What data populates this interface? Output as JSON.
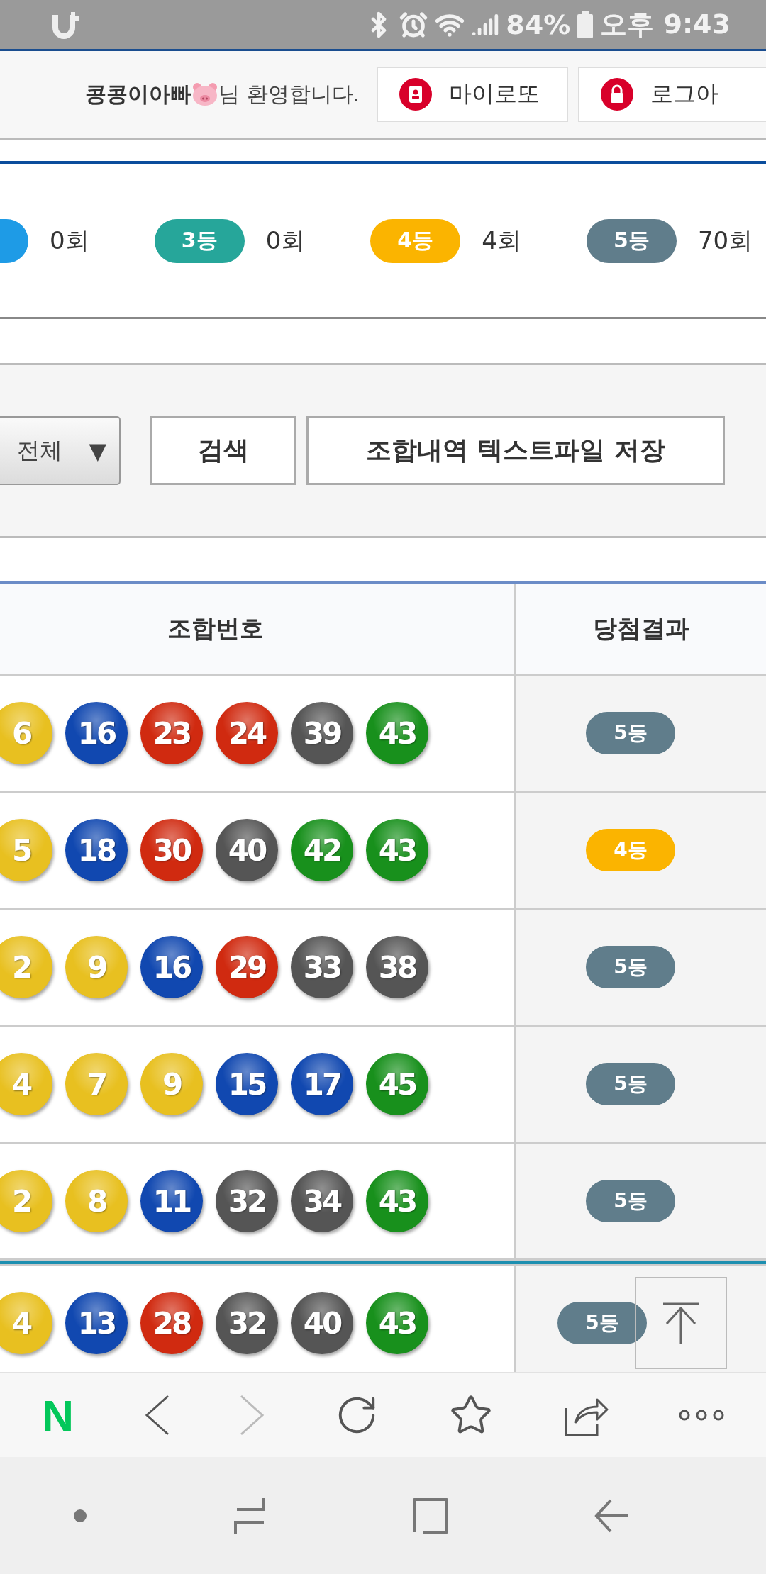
{
  "status_bar": {
    "battery": "84%",
    "time": "오후 9:43"
  },
  "header": {
    "user_name": "콩콩이아빠",
    "welcome": "님 환영합니다.",
    "buttons": [
      {
        "label": "마이로또",
        "kind": "mylotto"
      },
      {
        "label": "로그아",
        "kind": "logout"
      }
    ]
  },
  "stats": [
    {
      "color": "#1e9be6",
      "count": "0회"
    },
    {
      "label": "3등",
      "color": "#26a69a",
      "count": "0회"
    },
    {
      "label": "4등",
      "color": "#fbb400",
      "count": "4회"
    },
    {
      "label": "5등",
      "color": "#607d8b",
      "count": "70회"
    }
  ],
  "filter": {
    "select": "전체",
    "select_arrow": "▼",
    "buttons": [
      "검색",
      "조합내역 텍스트파일 저장"
    ]
  },
  "table": {
    "columns": [
      "조합번호",
      "당첨결과"
    ],
    "groups": [
      {
        "rows": [
          {
            "balls": [
              {
                "number": "6",
                "color": "#e8c020"
              },
              {
                "number": "16",
                "color": "#1148b0"
              },
              {
                "number": "23",
                "color": "#d02a10"
              },
              {
                "number": "24",
                "color": "#d02a10"
              },
              {
                "number": "39",
                "color": "#555555"
              },
              {
                "number": "43",
                "color": "#18901c"
              }
            ],
            "result": {
              "label": "5등",
              "color": "#607d8b"
            }
          },
          {
            "balls": [
              {
                "number": "5",
                "color": "#e8c020"
              },
              {
                "number": "18",
                "color": "#1148b0"
              },
              {
                "number": "30",
                "color": "#d02a10"
              },
              {
                "number": "40",
                "color": "#555555"
              },
              {
                "number": "42",
                "color": "#18901c"
              },
              {
                "number": "43",
                "color": "#18901c"
              }
            ],
            "result": {
              "label": "4등",
              "color": "#fbb400"
            }
          },
          {
            "balls": [
              {
                "number": "2",
                "color": "#e8c020"
              },
              {
                "number": "9",
                "color": "#e8c020"
              },
              {
                "number": "16",
                "color": "#1148b0"
              },
              {
                "number": "29",
                "color": "#d02a10"
              },
              {
                "number": "33",
                "color": "#555555"
              },
              {
                "number": "38",
                "color": "#555555"
              }
            ],
            "result": {
              "label": "5등",
              "color": "#607d8b"
            }
          },
          {
            "balls": [
              {
                "number": "4",
                "color": "#e8c020"
              },
              {
                "number": "7",
                "color": "#e8c020"
              },
              {
                "number": "9",
                "color": "#e8c020"
              },
              {
                "number": "15",
                "color": "#1148b0"
              },
              {
                "number": "17",
                "color": "#1148b0"
              },
              {
                "number": "45",
                "color": "#18901c"
              }
            ],
            "result": {
              "label": "5등",
              "color": "#607d8b"
            }
          },
          {
            "balls": [
              {
                "number": "2",
                "color": "#e8c020"
              },
              {
                "number": "8",
                "color": "#e8c020"
              },
              {
                "number": "11",
                "color": "#1148b0"
              },
              {
                "number": "32",
                "color": "#555555"
              },
              {
                "number": "34",
                "color": "#555555"
              },
              {
                "number": "43",
                "color": "#18901c"
              }
            ],
            "result": {
              "label": "5등",
              "color": "#607d8b"
            }
          }
        ]
      },
      {
        "rows": [
          {
            "balls": [
              {
                "number": "4",
                "color": "#e8c020"
              },
              {
                "number": "13",
                "color": "#1148b0"
              },
              {
                "number": "28",
                "color": "#d02a10"
              },
              {
                "number": "32",
                "color": "#555555"
              },
              {
                "number": "40",
                "color": "#555555"
              },
              {
                "number": "43",
                "color": "#18901c"
              }
            ],
            "result": {
              "label": "5등",
              "color": "#607d8b"
            }
          }
        ]
      }
    ]
  },
  "browser_bar": {
    "logo": "N",
    "forward_disabled": true
  }
}
